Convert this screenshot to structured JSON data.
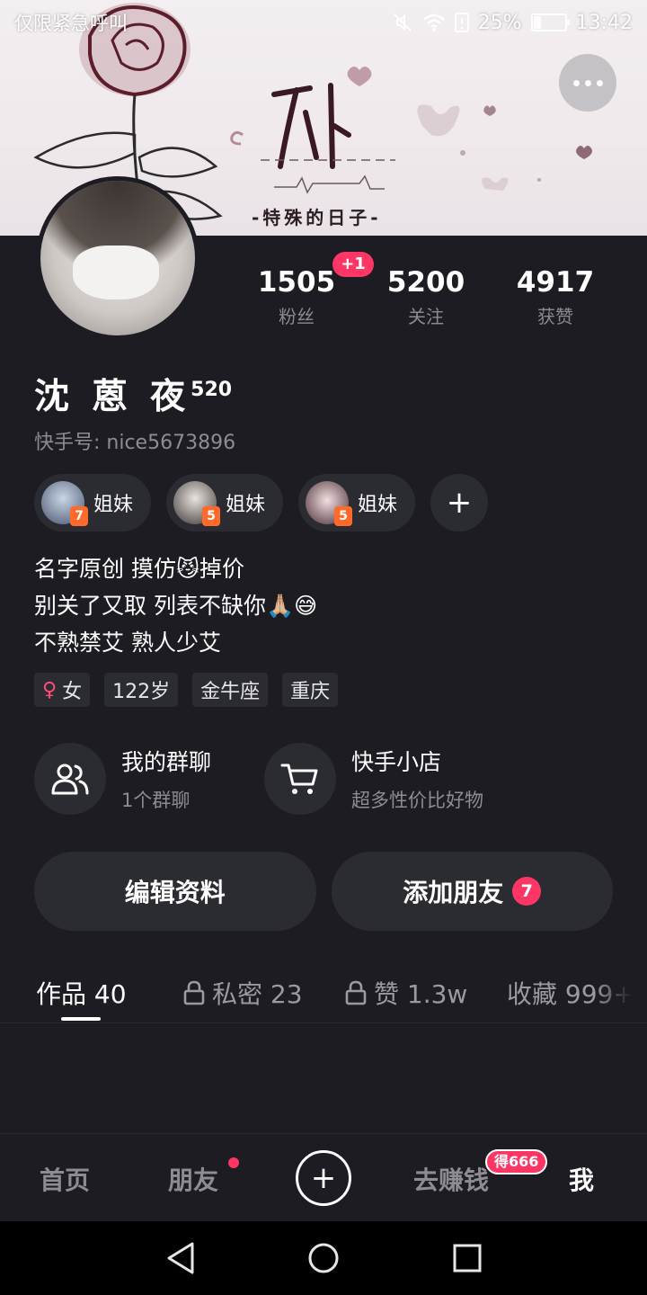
{
  "status_bar": {
    "left_text": "仅限紧急呼叫",
    "battery_percent": "25%",
    "battery_level": 0.25,
    "time": "13:42"
  },
  "banner": {
    "title": "-特殊的日子-"
  },
  "profile": {
    "name": "沈 蒽 夜",
    "name_suffix": "520",
    "user_id": "快手号: nice5673896",
    "new_fans_badge": "+1",
    "stats": [
      {
        "value": "1505",
        "label": "粉丝"
      },
      {
        "value": "5200",
        "label": "关注"
      },
      {
        "value": "4917",
        "label": "获赞"
      }
    ]
  },
  "relation_chips": [
    {
      "label": "姐妹",
      "level": "7"
    },
    {
      "label": "姐妹",
      "level": "5"
    },
    {
      "label": "姐妹",
      "level": "5"
    }
  ],
  "add_chip_label": "+",
  "bio": {
    "line1": "名字原创  摸仿😼掉价",
    "line2": "别关了又取  列表不缺你🙏🏼😅",
    "line3": "不熟禁艾  熟人少艾"
  },
  "tags": {
    "gender": "女",
    "age": "122岁",
    "zodiac": "金牛座",
    "city": "重庆"
  },
  "shortcuts": {
    "group_chat": {
      "title": "我的群聊",
      "subtitle": "1个群聊"
    },
    "shop": {
      "title": "快手小店",
      "subtitle": "超多性价比好物"
    }
  },
  "actions": {
    "edit_profile": "编辑资料",
    "add_friend": "添加朋友",
    "add_friend_badge": "7"
  },
  "tabs": [
    {
      "label": "作品 40"
    },
    {
      "label": "私密 23"
    },
    {
      "label": "赞 1.3w"
    },
    {
      "label": "收藏 999+"
    }
  ],
  "bottom_nav": {
    "home": "首页",
    "friends": "朋友",
    "create": "+",
    "earn": "去赚钱",
    "earn_badge": "得666",
    "me": "我"
  },
  "colors": {
    "background": "#1c1c22",
    "chip": "#2b2b32",
    "accent": "#fe3666"
  }
}
